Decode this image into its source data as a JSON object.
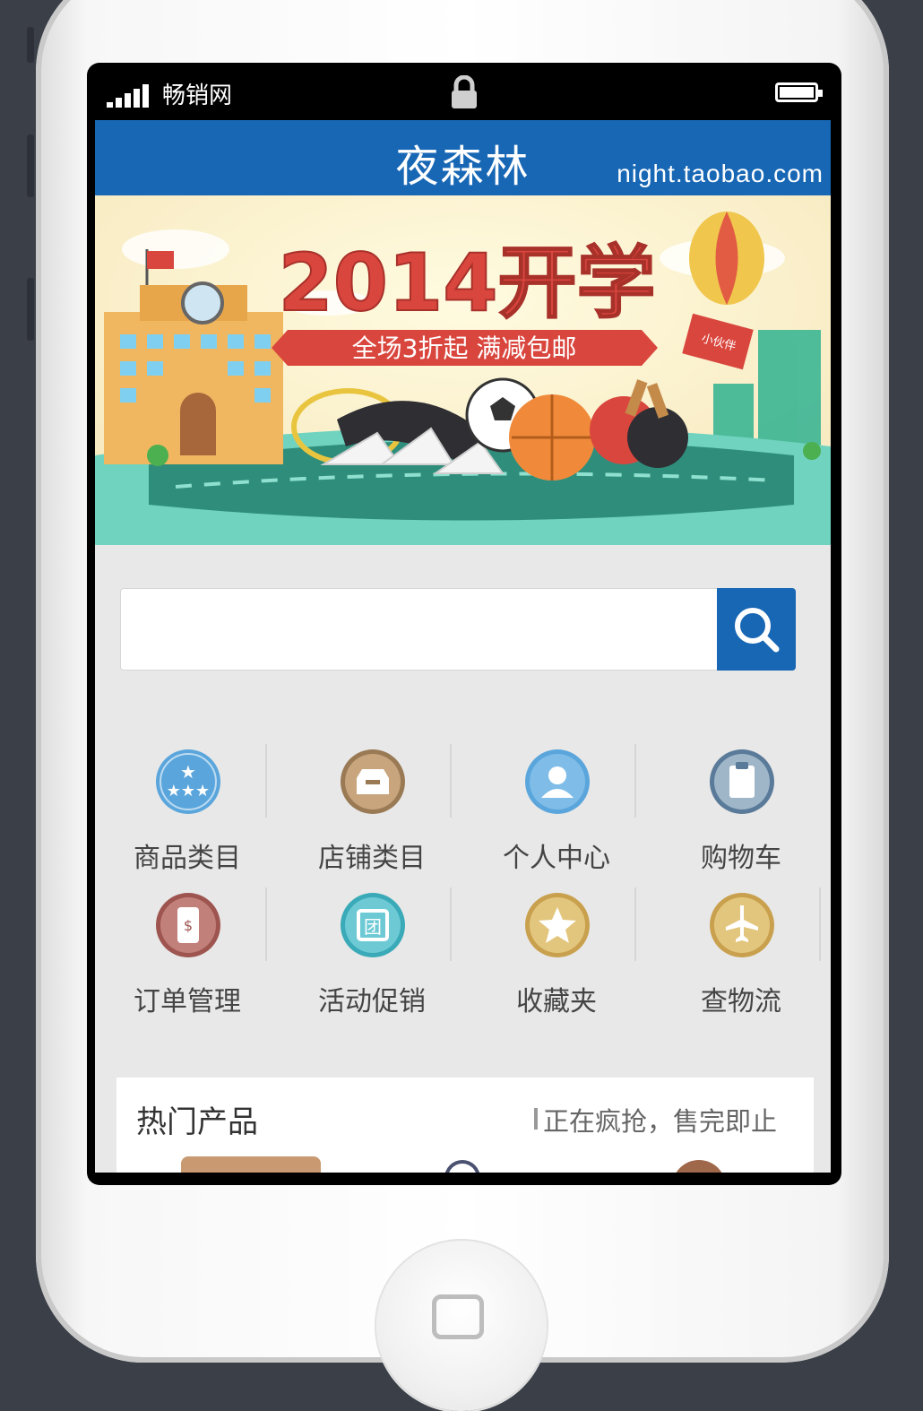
{
  "status_bar": {
    "carrier": "畅销网",
    "signal_icon": "signal-bars-icon",
    "lock_icon": "lock-icon",
    "battery_icon": "battery-icon"
  },
  "header": {
    "title": "夜森林",
    "domain": "night.taobao.com"
  },
  "banner": {
    "headline": "2014开学",
    "ribbon": "全场3折起 满减包邮",
    "tag": "小伙伴"
  },
  "search": {
    "value": "",
    "placeholder": "",
    "button_icon": "search-icon"
  },
  "nav_grid": [
    {
      "label": "商品类目",
      "icon": "stars-icon",
      "color": "#5aa6dc"
    },
    {
      "label": "店铺类目",
      "icon": "box-icon",
      "color": "#9a7a55"
    },
    {
      "label": "个人中心",
      "icon": "user-icon",
      "color": "#5aa6dc"
    },
    {
      "label": "购物车",
      "icon": "clipboard-icon",
      "color": "#5a7a99"
    },
    {
      "label": "订单管理",
      "icon": "phone-dollar-icon",
      "color": "#9e5550"
    },
    {
      "label": "活动促销",
      "icon": "group-buy-icon",
      "color": "#3aaab8"
    },
    {
      "label": "收藏夹",
      "icon": "star-icon",
      "color": "#c9a14e"
    },
    {
      "label": "查物流",
      "icon": "airplane-icon",
      "color": "#c9a14e"
    }
  ],
  "hot_products": {
    "title": "热门产品",
    "subtitle": "正在疯抢，售完即止"
  },
  "colors": {
    "brand_blue": "#1767b5",
    "banner_indicator": "#d4252b"
  }
}
